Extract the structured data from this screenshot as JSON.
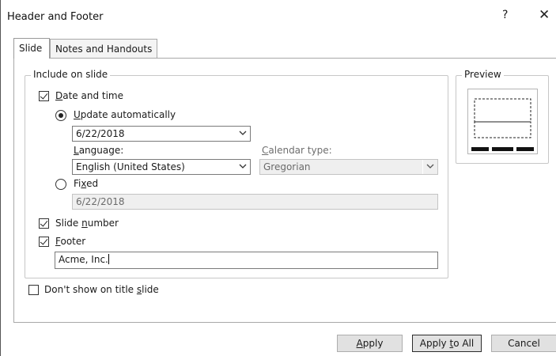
{
  "window": {
    "title": "Header and Footer",
    "help_glyph": "?",
    "close_glyph": "✕"
  },
  "tabs": [
    {
      "label": "Slide",
      "active": true
    },
    {
      "label": "Notes and Handouts",
      "active": false
    }
  ],
  "include_group": {
    "legend": "Include on slide",
    "date_time": {
      "checked": true,
      "label_pre": "",
      "label_key": "D",
      "label_post": "ate and time",
      "update_auto": {
        "selected": true,
        "label_key": "U",
        "label_post": "pdate automatically",
        "date_value": "6/22/2018"
      },
      "language": {
        "label_key": "L",
        "label_post": "anguage:",
        "value": "English (United States)"
      },
      "calendar": {
        "label_key": "C",
        "label_post": "alendar type:",
        "value": "Gregorian"
      },
      "fixed": {
        "selected": false,
        "label_pre": "Fi",
        "label_key": "x",
        "label_post": "ed",
        "value": "6/22/2018"
      }
    },
    "slide_number": {
      "checked": true,
      "label_pre": "Slide ",
      "label_key": "n",
      "label_post": "umber"
    },
    "footer": {
      "checked": true,
      "label_key": "F",
      "label_post": "ooter",
      "value": "Acme, Inc."
    }
  },
  "dont_show_title": {
    "checked": false,
    "label_pre": "Don't show on title ",
    "label_key": "s",
    "label_post": "lide"
  },
  "preview": {
    "legend": "Preview"
  },
  "buttons": {
    "apply_key": "A",
    "apply_post": "pply",
    "apply_all_pre": "Apply ",
    "apply_all_key": "t",
    "apply_all_post": "o All",
    "cancel": "Cancel"
  },
  "colors": {
    "button_face": "#e1e1e1",
    "disabled_field": "#efefef",
    "border": "#7a7a7a"
  }
}
